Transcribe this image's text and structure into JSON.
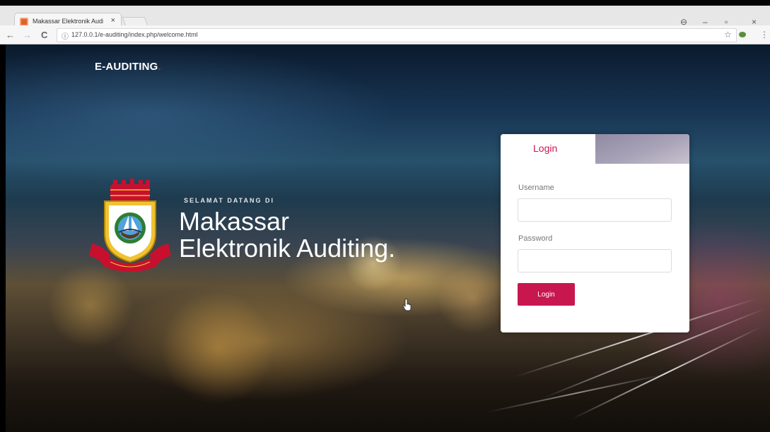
{
  "browser": {
    "tab_title": "Makassar Elektronik Audi",
    "tab_close": "×",
    "url_info_icon": "ⓘ",
    "url": "127.0.0.1/e-auditing/index.php/welcome.html",
    "back": "←",
    "forward": "→",
    "reload": "C",
    "star": "☆",
    "menu": "⋮",
    "win_profile": "⊖",
    "win_min": "–",
    "win_restore": "▫",
    "win_close": "×"
  },
  "page": {
    "brand": "E-AUDITING",
    "brand_dot": ".",
    "welcome": "SELAMAT DATANG DI",
    "hero_line1": "Makassar",
    "hero_line2": "Elektronik Auditing."
  },
  "login": {
    "tab_label": "Login",
    "username_label": "Username",
    "username_value": "",
    "password_label": "Password",
    "password_value": "",
    "submit_label": "Login"
  },
  "colors": {
    "accent": "#c8174f",
    "brand_text": "#ffffff"
  },
  "icons": {
    "favicon": "site-favicon",
    "emblem": "makassar-city-emblem",
    "cursor": "hand-pointer-cursor"
  }
}
